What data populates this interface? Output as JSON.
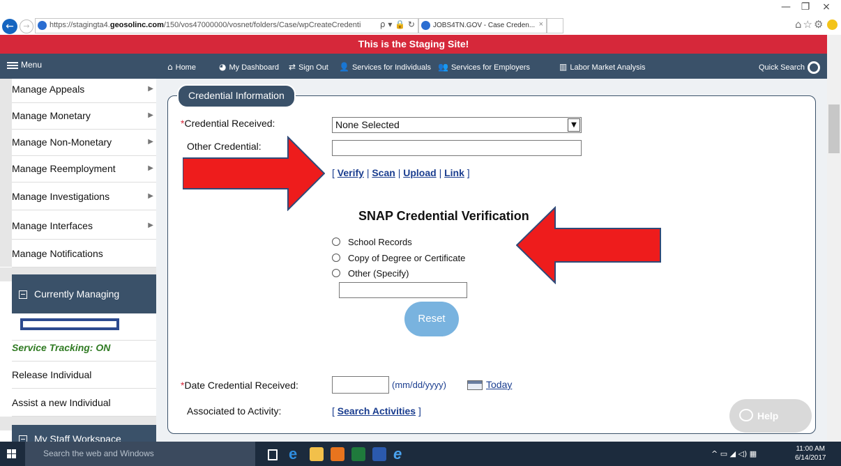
{
  "browser": {
    "url_prefix": "https://stagingta4.",
    "url_domain": "geosolinc.com",
    "url_suffix": "/150/vos47000000/vosnet/folders/Case/wpCreateCredenti",
    "addr_icons": "ρ ▾ 🔒 ↻",
    "tab_title": "JOBS4TN.GOV - Case Creden...",
    "tab_close": "×",
    "win_minimize": "—",
    "win_restore": "❐",
    "win_close": "×",
    "toolbar_icons": "⌂☆⚙"
  },
  "banner": {
    "text": "This is the Staging Site!"
  },
  "navbar": {
    "menu_label": "Menu",
    "items": [
      {
        "icon": "home-icon",
        "label": "Home"
      },
      {
        "icon": "dashboard-icon",
        "label": "My Dashboard"
      },
      {
        "icon": "sign-out-icon",
        "label": "Sign Out"
      },
      {
        "icon": "individuals-icon",
        "label": "Services for Individuals"
      },
      {
        "icon": "employers-icon",
        "label": "Services for Employers"
      },
      {
        "icon": "chart-icon",
        "label": "Labor Market Analysis"
      }
    ],
    "quick_search": "Quick Search"
  },
  "sidebar": {
    "items": [
      {
        "label": "Manage Appeals"
      },
      {
        "label": "Manage Monetary"
      },
      {
        "label": "Manage Non-Monetary"
      },
      {
        "label": "Manage Reemployment"
      },
      {
        "label": "Manage Investigations"
      },
      {
        "label": "Manage Interfaces"
      },
      {
        "label": "Manage Notifications"
      }
    ],
    "currently_managing": "Currently Managing",
    "service_tracking": "Service Tracking: ON",
    "release": "Release Individual",
    "assist": "Assist a new Individual",
    "staff_workspace": "My Staff Workspace"
  },
  "form": {
    "legend": "Credential Information",
    "credential_received_label": "Credential Received:",
    "credential_received_value": "None Selected",
    "other_credential_label": "Other Credential:",
    "other_credential_value": "",
    "links": {
      "open": "[",
      "verify": "Verify",
      "sep": "|",
      "scan": "Scan",
      "upload": "Upload",
      "link": "Link",
      "close": "]"
    },
    "snap_title": "SNAP Credential Verification",
    "radios": [
      "School Records",
      "Copy of Degree or Certificate",
      "Other (Specify)"
    ],
    "other_specify_value": "",
    "reset": "Reset",
    "date_label": "Date Credential Received:",
    "date_value": "",
    "date_format": "(mm/dd/yyyy)",
    "today": "Today",
    "activity_label": "Associated to Activity:",
    "search_activities": "Search Activities"
  },
  "help": {
    "label": "Help"
  },
  "taskbar": {
    "search_placeholder": "Search the web and Windows",
    "time": "11:00 AM",
    "date": "6/14/2017"
  },
  "colors": {
    "banner": "#d6283a",
    "nav": "#3a5169",
    "arrow": "#ee1c1c",
    "arrow_stroke": "#2f4a78",
    "reset": "#79b3df",
    "link": "#1a3d8f"
  }
}
